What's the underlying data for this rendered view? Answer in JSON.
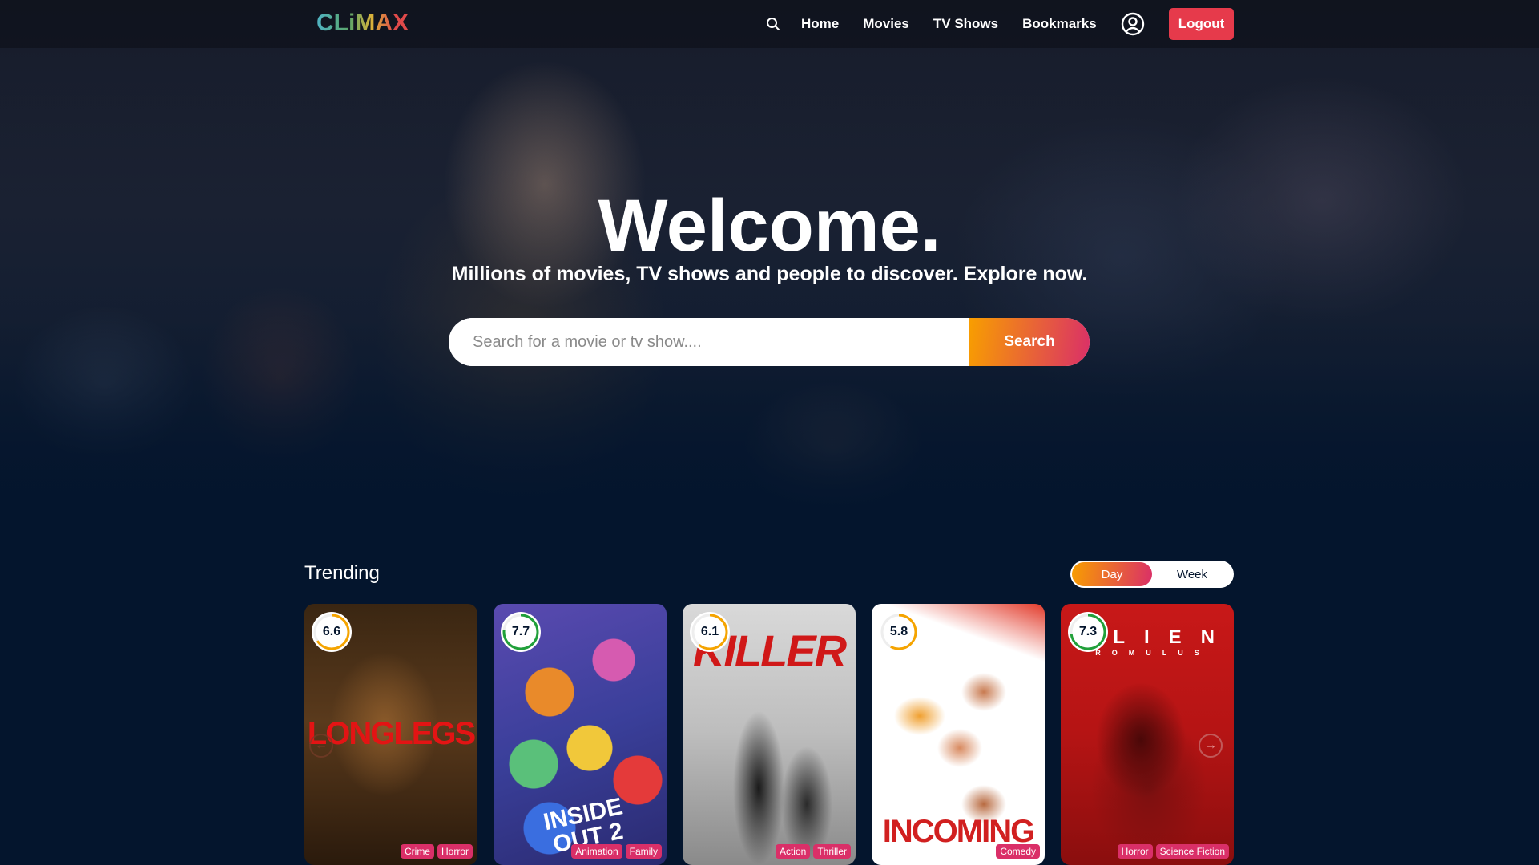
{
  "header": {
    "logo": "CLiMAX",
    "nav": [
      "Home",
      "Movies",
      "TV Shows",
      "Bookmarks"
    ],
    "logout": "Logout"
  },
  "hero": {
    "title": "Welcome.",
    "subtitle": "Millions of movies, TV shows and people to discover. Explore now.",
    "search_placeholder": "Search for a movie or tv show....",
    "search_button": "Search"
  },
  "trending": {
    "title": "Trending",
    "tabs": [
      "Day",
      "Week"
    ],
    "active_tab": "Day",
    "movies": [
      {
        "poster_text": "LONGLEGS",
        "rating": "6.6",
        "rating_value": 6.6,
        "genres": [
          "Crime",
          "Horror"
        ]
      },
      {
        "poster_text": "INSIDE OUT 2",
        "rating": "7.7",
        "rating_value": 7.7,
        "genres": [
          "Animation",
          "Family"
        ]
      },
      {
        "poster_text": "KILLER",
        "rating": "6.1",
        "rating_value": 6.1,
        "genres": [
          "Action",
          "Thriller"
        ]
      },
      {
        "poster_text": "INCOMING",
        "rating": "5.8",
        "rating_value": 5.8,
        "genres": [
          "Comedy"
        ]
      },
      {
        "poster_text": "ALIEN",
        "poster_subtext": "ROMULUS",
        "rating": "7.3",
        "rating_value": 7.3,
        "genres": [
          "Horror",
          "Science Fiction"
        ]
      }
    ]
  },
  "colors": {
    "background": "#04152d",
    "accent_orange": "#f89e00",
    "accent_pink": "#da2f68",
    "logout": "#e63a4b"
  }
}
